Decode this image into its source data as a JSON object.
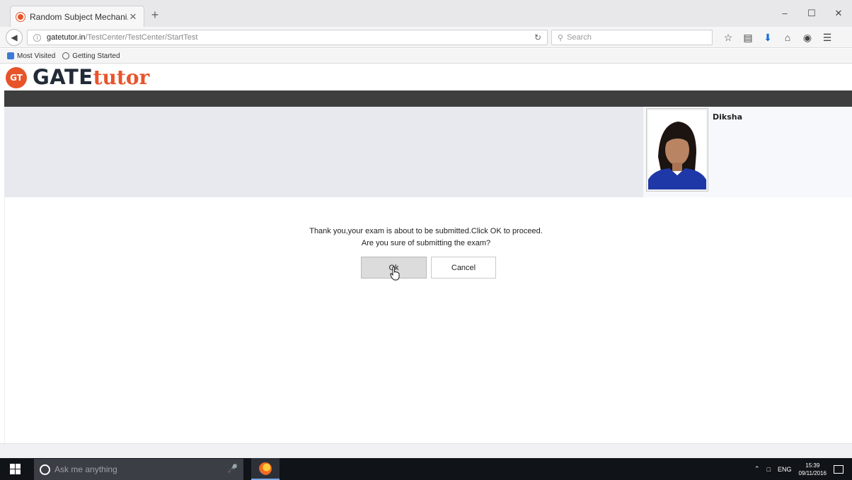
{
  "browser": {
    "tab_title": "Random Subject Mechani...",
    "tab_close": "✕",
    "new_tab": "+",
    "url_domain": "gatetutor.in",
    "url_path": "/TestCenter/TestCenter/StartTest",
    "search_placeholder": "Search",
    "bookmarks": [
      "Most Visited",
      "Getting Started"
    ],
    "window_controls": [
      "–",
      "☐",
      "✕"
    ]
  },
  "site": {
    "logo_badge": "GT",
    "logo_main": "GATE",
    "logo_accent": "tutor",
    "accent_color": "#e8542a"
  },
  "profile": {
    "name": "Diksha"
  },
  "dialog": {
    "message_line1": "Thank you,your exam is about to be submitted.Click OK to proceed.",
    "message_line2": "Are you sure of submitting the exam?",
    "ok_label": "Ok",
    "cancel_label": "Cancel"
  },
  "taskbar": {
    "search_placeholder": "Ask me anything",
    "language": "ENG",
    "time": "15:39",
    "date": "09/11/2016"
  }
}
